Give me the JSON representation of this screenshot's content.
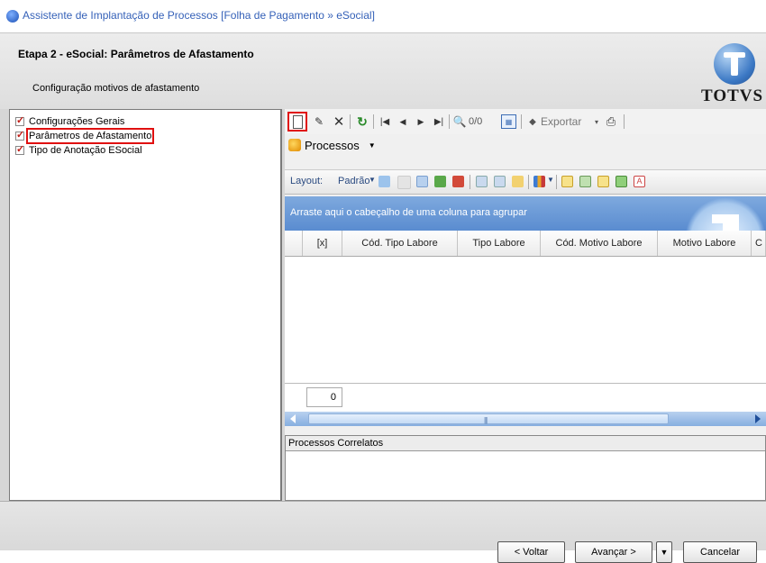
{
  "window": {
    "title": "Assistente de Implantação de Processos [Folha de Pagamento » eSocial]"
  },
  "header": {
    "step_title": "Etapa 2 - eSocial: Parâmetros de Afastamento",
    "subtitle": "Configuração motivos de afastamento",
    "logo_text": "TOTVS"
  },
  "tree": {
    "items": [
      {
        "label": "Configurações Gerais"
      },
      {
        "label": "Parâmetros de Afastamento",
        "selected": true
      },
      {
        "label": "Tipo de Anotação ESocial"
      }
    ]
  },
  "toolbar": {
    "nav_counter": "0/0",
    "export_label": "Exportar",
    "processos_label": "Processos"
  },
  "layout_bar": {
    "layout_label": "Layout:",
    "layout_value": "Padrão"
  },
  "grid": {
    "group_hint": "Arraste aqui o cabeçalho de uma coluna para agrupar",
    "columns": [
      "[x]",
      "Cód. Tipo Labore",
      "Tipo Labore",
      "Cód. Motivo Labore",
      "Motivo Labore",
      "C"
    ],
    "record_count": "0"
  },
  "related": {
    "title": "Processos Correlatos"
  },
  "buttons": {
    "back": "< Voltar",
    "next": "Avançar >",
    "cancel": "Cancelar"
  },
  "colors": {
    "accent_red": "#e01010",
    "group_bar_blue": "#6b9ad6",
    "title_blue": "#3561b8"
  }
}
